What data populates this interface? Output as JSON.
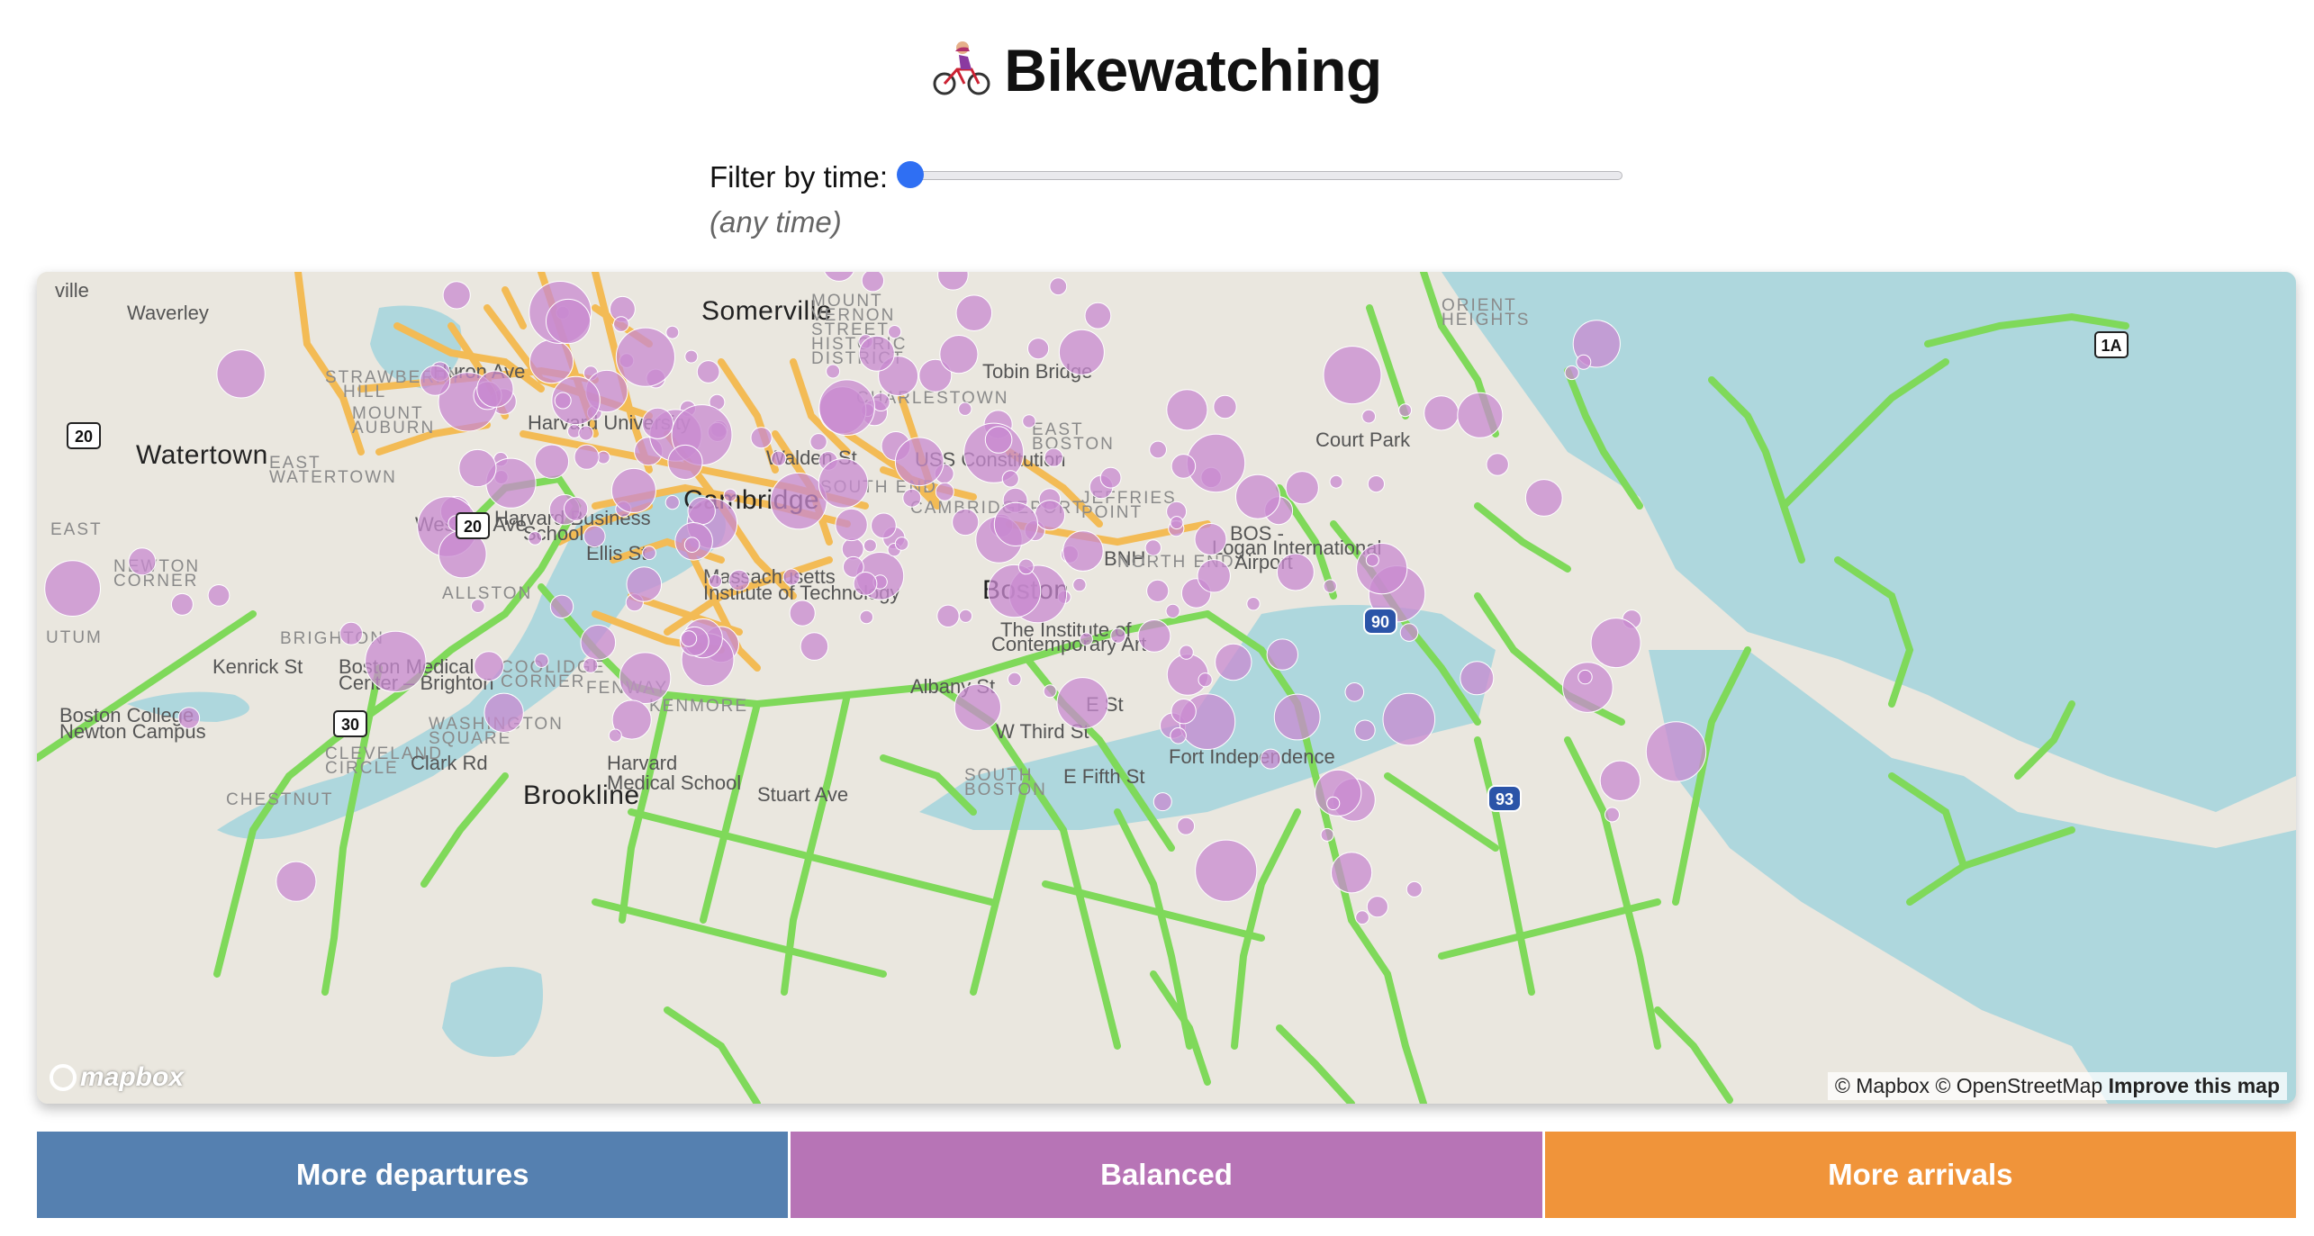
{
  "page": {
    "title": "Bikewatching"
  },
  "filter": {
    "label": "Filter by time:",
    "slider_value": 0,
    "time_display": "(any time)"
  },
  "map": {
    "places": [
      {
        "name": "Somerville",
        "cls": "big"
      },
      {
        "name": "Cambridge",
        "cls": "big"
      },
      {
        "name": "Boston",
        "cls": "big"
      },
      {
        "name": "Watertown",
        "cls": "big"
      },
      {
        "name": "Brookline",
        "cls": "big"
      },
      {
        "name": "Waverley",
        "cls": "sm"
      },
      {
        "name": "STRAWBERRY",
        "cls": "dist"
      },
      {
        "name": "HILL",
        "cls": "dist"
      },
      {
        "name": "MOUNT",
        "cls": "dist"
      },
      {
        "name": "AUBURN",
        "cls": "dist"
      },
      {
        "name": "EAST",
        "cls": "dist"
      },
      {
        "name": "WATERTOWN",
        "cls": "dist"
      },
      {
        "name": "NEWTON",
        "cls": "dist"
      },
      {
        "name": "CORNER",
        "cls": "dist"
      },
      {
        "name": "BRIGHTON",
        "cls": "dist"
      },
      {
        "name": "ALLSTON",
        "cls": "dist"
      },
      {
        "name": "CHARLESTOWN",
        "cls": "dist"
      },
      {
        "name": "EAST",
        "cls": "dist"
      },
      {
        "name": "BOSTON",
        "cls": "dist"
      },
      {
        "name": "ORIENT",
        "cls": "dist"
      },
      {
        "name": "HEIGHTS",
        "cls": "dist"
      },
      {
        "name": "JEFFRIES",
        "cls": "dist"
      },
      {
        "name": "POINT",
        "cls": "dist"
      },
      {
        "name": "SOUTH",
        "cls": "dist"
      },
      {
        "name": "BOSTON",
        "cls": "dist"
      },
      {
        "name": "WASHINGTON",
        "cls": "dist"
      },
      {
        "name": "SQUARE",
        "cls": "dist"
      },
      {
        "name": "CLEVELAND",
        "cls": "dist"
      },
      {
        "name": "CIRCLE",
        "cls": "dist"
      },
      {
        "name": "CHESTNUT",
        "cls": "dist"
      },
      {
        "name": "COOLIDGE",
        "cls": "dist"
      },
      {
        "name": "CORNER",
        "cls": "dist"
      },
      {
        "name": "KENMORE",
        "cls": "dist"
      },
      {
        "name": "FENWAY",
        "cls": "dist"
      },
      {
        "name": "MOUNT",
        "cls": "dist"
      },
      {
        "name": "VERNON",
        "cls": "dist"
      },
      {
        "name": "STREET",
        "cls": "dist"
      },
      {
        "name": "HISTORIC",
        "cls": "dist"
      },
      {
        "name": "DISTRICT",
        "cls": "dist"
      },
      {
        "name": "Harvard University",
        "cls": "sm"
      },
      {
        "name": "Harvard Business",
        "cls": "sm"
      },
      {
        "name": "School",
        "cls": "sm"
      },
      {
        "name": "Massachusetts",
        "cls": "sm"
      },
      {
        "name": "Institute of Technology",
        "cls": "sm"
      },
      {
        "name": "Boston Medical",
        "cls": "sm"
      },
      {
        "name": "Center – Brighton",
        "cls": "sm"
      },
      {
        "name": "Boston College",
        "cls": "sm"
      },
      {
        "name": "Newton Campus",
        "cls": "sm"
      },
      {
        "name": "USS Constitution",
        "cls": "sm"
      },
      {
        "name": "BOS -",
        "cls": "sm"
      },
      {
        "name": "Logan International",
        "cls": "sm"
      },
      {
        "name": "Airport",
        "cls": "sm"
      },
      {
        "name": "Court Park",
        "cls": "sm"
      },
      {
        "name": "The Institute of",
        "cls": "sm"
      },
      {
        "name": "Contemporary Art",
        "cls": "sm"
      },
      {
        "name": "Fort Independence",
        "cls": "sm"
      },
      {
        "name": "Kenrick St",
        "cls": "sm"
      },
      {
        "name": "Harvard",
        "cls": "sm"
      },
      {
        "name": "Medical School",
        "cls": "sm"
      },
      {
        "name": "BNH",
        "cls": "sm"
      },
      {
        "name": "Huron Ave",
        "cls": "sm"
      },
      {
        "name": "Western Ave",
        "cls": "sm"
      },
      {
        "name": "Clark Rd",
        "cls": "sm"
      },
      {
        "name": "Tobin Bridge",
        "cls": "sm"
      },
      {
        "name": "E Fifth St",
        "cls": "sm"
      },
      {
        "name": "W Third St",
        "cls": "sm"
      },
      {
        "name": "E St",
        "cls": "sm"
      },
      {
        "name": "Albany St",
        "cls": "sm"
      },
      {
        "name": "Stuart Ave",
        "cls": "sm"
      },
      {
        "name": "Walden St",
        "cls": "sm"
      },
      {
        "name": "Ellis St",
        "cls": "sm"
      },
      {
        "name": "CAMBRIDGEPORT",
        "cls": "dist"
      },
      {
        "name": "NORTH END",
        "cls": "dist"
      },
      {
        "name": "SOUTH END",
        "cls": "dist"
      },
      {
        "name": "EAST",
        "cls": "dist"
      },
      {
        "name": "UTUM",
        "cls": "dist"
      },
      {
        "name": "ville",
        "cls": "sm"
      }
    ],
    "highway_shields": [
      "20",
      "20",
      "30",
      "90",
      "93",
      "1A"
    ],
    "attribution": {
      "mapbox": "© Mapbox",
      "osm": "© OpenStreetMap",
      "improve": "Improve this map"
    },
    "logo_text": "mapbox"
  },
  "legend": {
    "items": [
      {
        "label": "More departures",
        "color": "#5580b0"
      },
      {
        "label": "Balanced",
        "color": "#b774b6"
      },
      {
        "label": "More arrivals",
        "color": "#f0943a"
      }
    ]
  },
  "colors": {
    "station_fill": "#c88ad0",
    "bike_lane": "#7fd95a",
    "cambridge_lane": "#f3bb55",
    "water": "#aed7dd",
    "land": "#eae7df"
  }
}
